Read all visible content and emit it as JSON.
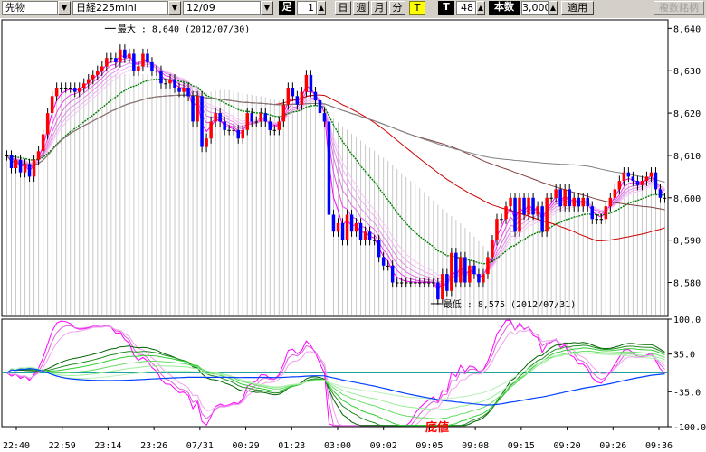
{
  "toolbar": {
    "category": "先物",
    "instrument": "日経225mini",
    "contract": "12/09",
    "foot_label": "足",
    "foot_value": "1",
    "day": "日",
    "week": "週",
    "month": "月",
    "minute": "分",
    "tick": "T",
    "t_label": "T",
    "bar_count": "48",
    "count_label": "本数",
    "count_value": "3,000",
    "apply": "適用",
    "multi": "複数銘柄"
  },
  "colors": {
    "up": "#ff0000",
    "down": "#0000ff",
    "neutral": "#000000",
    "bg": "#ffffff"
  },
  "chart_data": [
    {
      "type": "candlestick",
      "ylim": [
        8572,
        8642
      ],
      "y_ticks": [
        "8,640",
        "8,630",
        "8,620",
        "8,610",
        "8,600",
        "8,590",
        "8,580"
      ],
      "y_tick_values": [
        8640,
        8630,
        8620,
        8610,
        8600,
        8590,
        8580
      ],
      "x_tick_labels": [
        "22:40",
        "22:59",
        "23:14",
        "23:26",
        "07/31",
        "00:29",
        "01:23",
        "03:00",
        "09:02",
        "09:05",
        "09:08",
        "09:15",
        "09:20",
        "09:26",
        "09:36"
      ],
      "annotations": {
        "max": {
          "text": "最大 : 8,640 (2012/07/30)",
          "value": 8640,
          "bar": 24
        },
        "min": {
          "text": "最低 : 8,575 (2012/07/31)",
          "value": 8575,
          "bar": 95
        }
      },
      "close": [
        8610,
        8607,
        8609,
        8606,
        8608,
        8605,
        8609,
        8611,
        8615,
        8620,
        8624,
        8626,
        8626,
        8626,
        8626,
        8625,
        8626,
        8627,
        8628,
        8629,
        8630,
        8631,
        8633,
        8633,
        8632,
        8635,
        8633,
        8634,
        8630,
        8631,
        8634,
        8632,
        8630,
        8630,
        8627,
        8627,
        8628,
        8626,
        8625,
        8626,
        8624,
        8618,
        8624,
        8612,
        8614,
        8618,
        8620,
        8618,
        8616,
        8616,
        8616,
        8614,
        8616,
        8620,
        8618,
        8618,
        8620,
        8618,
        8616,
        8616,
        8618,
        8622,
        8626,
        8624,
        8622,
        8625,
        8629,
        8625,
        8623,
        8620,
        8618,
        8596,
        8592,
        8594,
        8590,
        8596,
        8592,
        8594,
        8590,
        8592,
        8590,
        8590,
        8586,
        8584,
        8584,
        8580,
        8580,
        8580,
        8580,
        8580,
        8580,
        8580,
        8580,
        8580,
        8580,
        8576,
        8582,
        8578,
        8587,
        8580,
        8586,
        8580,
        8584,
        8582,
        8580,
        8582,
        8586,
        8590,
        8595,
        8595,
        8598,
        8600,
        8592,
        8600,
        8596,
        8600,
        8596,
        8598,
        8592,
        8600,
        8600,
        8602,
        8598,
        8602,
        8598,
        8600,
        8598,
        8600,
        8598,
        8595,
        8595,
        8595,
        8598,
        8600,
        8602,
        8604,
        8606,
        8605,
        8604,
        8603,
        8604,
        8605,
        8606,
        8602,
        8600,
        8600
      ]
    },
    {
      "type": "line",
      "ylim": [
        -100,
        100
      ],
      "y_ticks": [
        "100.0",
        "35.0",
        "-35.0",
        "-100.0"
      ],
      "y_tick_values": [
        100,
        35,
        -35,
        -100
      ],
      "annotation": {
        "text": "底値",
        "value": -95
      }
    }
  ]
}
